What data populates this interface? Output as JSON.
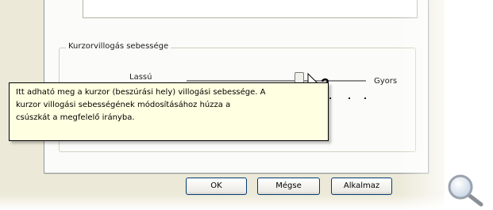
{
  "window": {
    "group_title": "Kurzorvillogás sebessége"
  },
  "slider": {
    "min_label": "Lassú",
    "max_label": "Gyors",
    "value": 0.6
  },
  "tooltip": {
    "lines": [
      "Itt adható meg a kurzor (beszúrási hely) villogási sebessége. A",
      "kurzor villogási sebességének módosításához húzza a",
      "csúszkát a megfelelő irányba."
    ]
  },
  "buttons": {
    "ok": "OK",
    "cancel": "Mégse",
    "apply": "Alkalmaz"
  },
  "icons": {
    "cursor": "help-cursor-icon",
    "zoom": "magnifier-icon"
  }
}
